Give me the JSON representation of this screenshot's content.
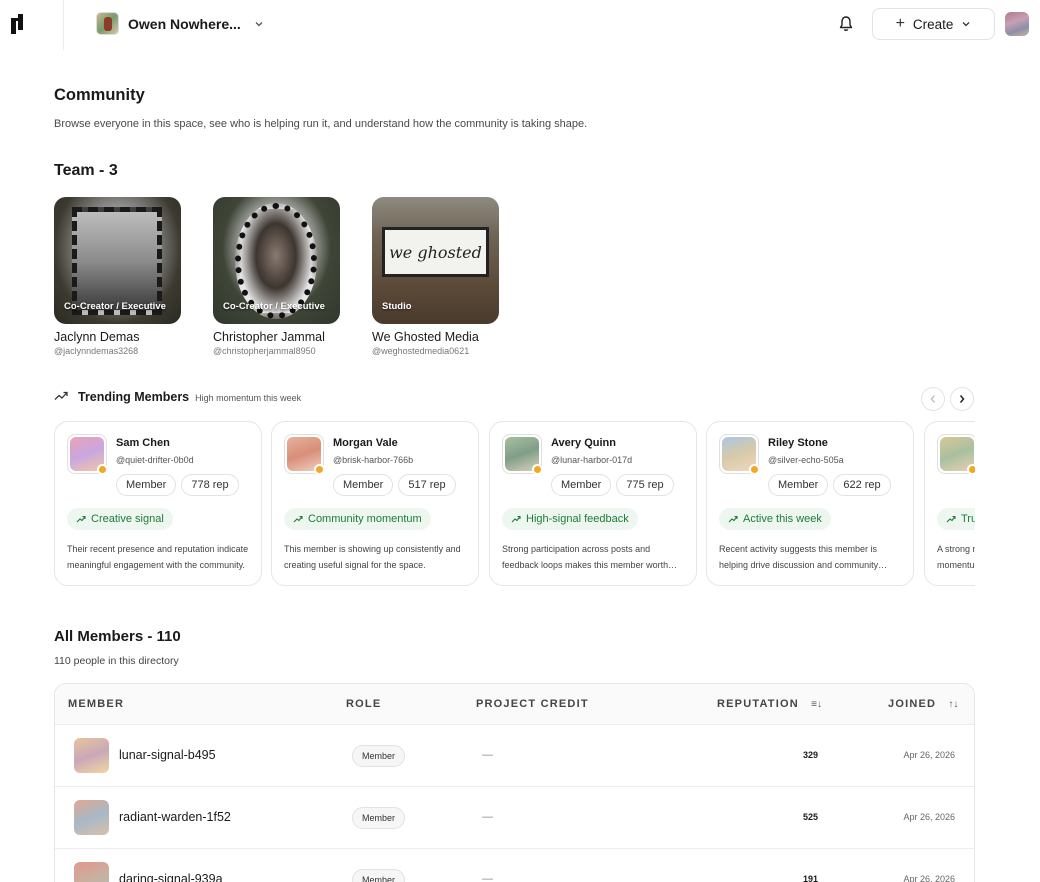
{
  "topbar": {
    "workspace_name": "Owen Nowhere...",
    "create_label": "Create"
  },
  "page": {
    "title": "Community",
    "subtitle": "Browse everyone in this space, see who is helping run it, and understand how the community is taking shape."
  },
  "team": {
    "title": "Team - 3",
    "members": [
      {
        "name": "Jaclynn Demas",
        "handle": "@jaclynndemas3268",
        "role": "Co-Creator / Executive"
      },
      {
        "name": "Christopher Jammal",
        "handle": "@christopherjammal8950",
        "role": "Co-Creator / Executive"
      },
      {
        "name": "We Ghosted Media",
        "handle": "@weghostedmedia0621",
        "role": "Studio",
        "sign_text": "we ghosted"
      }
    ]
  },
  "trending": {
    "title": "Trending Members",
    "subtitle": "High momentum this week",
    "cards": [
      {
        "name": "Sam Chen",
        "handle": "@quiet-drifter-0b0d",
        "role": "Member",
        "rep": "778 rep",
        "signal": "Creative signal",
        "desc": "Their recent presence and reputation indicate meaningful engagement with the community.",
        "colors": [
          "#e9a3b6",
          "#c9a6e0",
          "#f2c7a6"
        ]
      },
      {
        "name": "Morgan Vale",
        "handle": "@brisk-harbor-766b",
        "role": "Member",
        "rep": "517 rep",
        "signal": "Community momentum",
        "desc": "This member is showing up consistently and creating useful signal for the space.",
        "colors": [
          "#e6b19a",
          "#d88f7a",
          "#f0cfc0"
        ]
      },
      {
        "name": "Avery Quinn",
        "handle": "@lunar-harbor-017d",
        "role": "Member",
        "rep": "775 rep",
        "signal": "High-signal feedback",
        "desc": "Strong participation across posts and feedback loops makes this member worth following.",
        "colors": [
          "#a8bfa0",
          "#7f9e88",
          "#d8d2b8"
        ]
      },
      {
        "name": "Riley Stone",
        "handle": "@silver-echo-505a",
        "role": "Member",
        "rep": "622 rep",
        "signal": "Active this week",
        "desc": "Recent activity suggests this member is helping drive discussion and community growth.",
        "colors": [
          "#a9c8e6",
          "#d8c9a8",
          "#f0d8c0"
        ]
      },
      {
        "name": "",
        "handle": "",
        "role": "",
        "rep": "",
        "signal": "Trusted voice",
        "desc": "A strong mix of role, credibility and momentum in the community.",
        "colors": [
          "#d8c89a",
          "#a8c0a0",
          "#e8d0b0"
        ]
      }
    ]
  },
  "members": {
    "title": "All Members - 110",
    "subtitle": "110 people in this directory",
    "columns": {
      "member": "MEMBER",
      "role": "ROLE",
      "credit": "PROJECT CREDIT",
      "reputation": "REPUTATION",
      "joined": "JOINED"
    },
    "rows": [
      {
        "name": "lunar-signal-b495",
        "role": "Member",
        "credit": "—",
        "reputation": "329",
        "joined": "Apr 26, 2026",
        "colors": [
          "#e8c49a",
          "#c9a8b8",
          "#f0d8a0"
        ]
      },
      {
        "name": "radiant-warden-1f52",
        "role": "Member",
        "credit": "—",
        "reputation": "525",
        "joined": "Apr 26, 2026",
        "colors": [
          "#e0a890",
          "#a8b8c8",
          "#d8c0a8"
        ]
      },
      {
        "name": "daring-signal-939a",
        "role": "Member",
        "credit": "—",
        "reputation": "191",
        "joined": "Apr 26, 2026",
        "colors": [
          "#e09890",
          "#c8b0a0",
          "#a8c0c8"
        ]
      }
    ]
  }
}
